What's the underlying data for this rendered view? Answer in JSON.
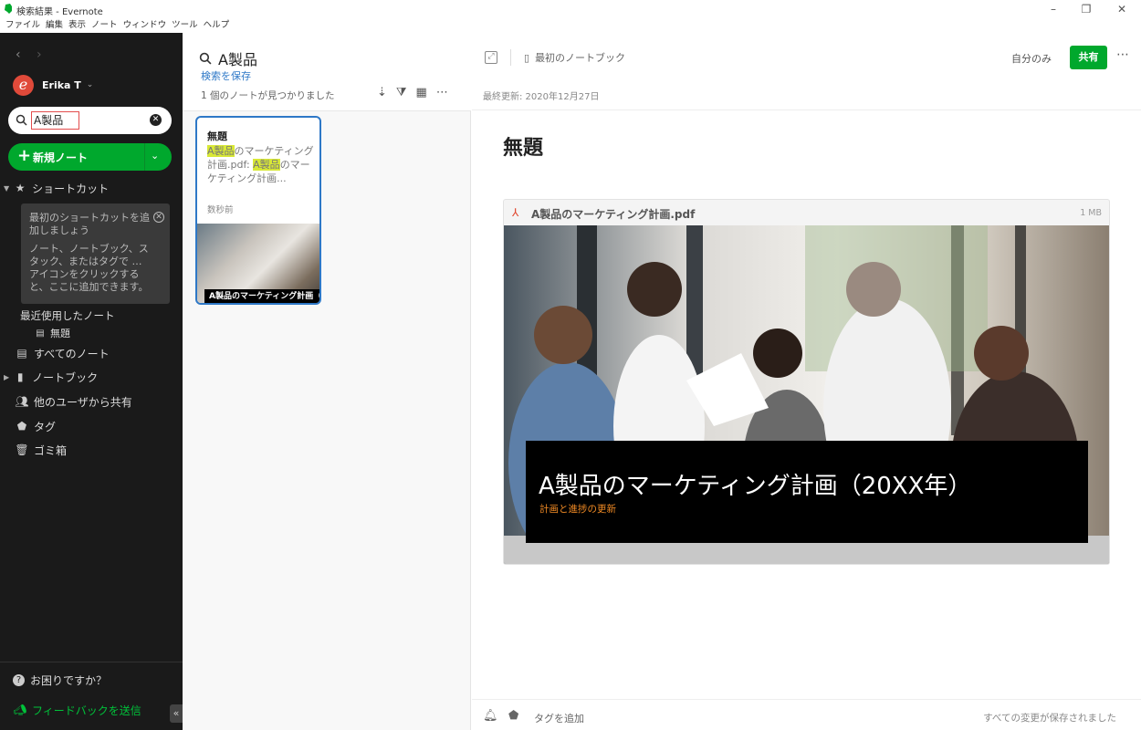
{
  "window": {
    "title": "検索結果 - Evernote"
  },
  "menu": [
    "ファイル",
    "編集",
    "表示",
    "ノート",
    "ウィンドウ",
    "ツール",
    "ヘルプ"
  ],
  "sidebar": {
    "user": "Erika T",
    "avatar_letter": "e",
    "search_value": "A製品",
    "new_note_label": "新規ノート",
    "shortcuts_label": "ショートカット",
    "shortcut_tip_1": "最初のショートカットを追加しましょう",
    "shortcut_tip_2": "ノート、ノートブック、スタック、またはタグで … アイコンをクリックすると、ここに追加できます。",
    "recent_label": "最近使用したノート",
    "recent_item": "無題",
    "all_notes": "すべてのノート",
    "notebooks": "ノートブック",
    "shared": "他のユーザから共有",
    "tags": "タグ",
    "trash": "ゴミ箱",
    "help": "お困りですか？",
    "feedback": "フィードバックを送信"
  },
  "list": {
    "query_title": "A製品",
    "save_search": "検索を保存",
    "result_count": "1 個のノートが見つかりました",
    "card": {
      "title": "無題",
      "hl1": "A製品",
      "text1": "のマーケティング計画.pdf: ",
      "hl2": "A製品",
      "text2": "のマーケティング計画...",
      "time": "数秒前",
      "thumb_caption": "A製品のマーケティング計画（"
    }
  },
  "editor": {
    "notebook": "最初のノートブック",
    "only_me": "自分のみ",
    "share": "共有",
    "last_updated": "最終更新: 2020年12月27日",
    "note_title": "無題",
    "attachment_name": "A製品のマーケティング計画.pdf",
    "attachment_size": "1 MB",
    "slide_title": "A製品のマーケティング計画（20XX年）",
    "slide_subtitle": "計画と進捗の更新",
    "add_tag": "タグを追加",
    "saved_status": "すべての変更が保存されました"
  },
  "colors": {
    "accent_green": "#00a82d",
    "sidebar_bg": "#1a1a1a",
    "link_blue": "#2e78c7",
    "highlight": "#d8e836"
  }
}
